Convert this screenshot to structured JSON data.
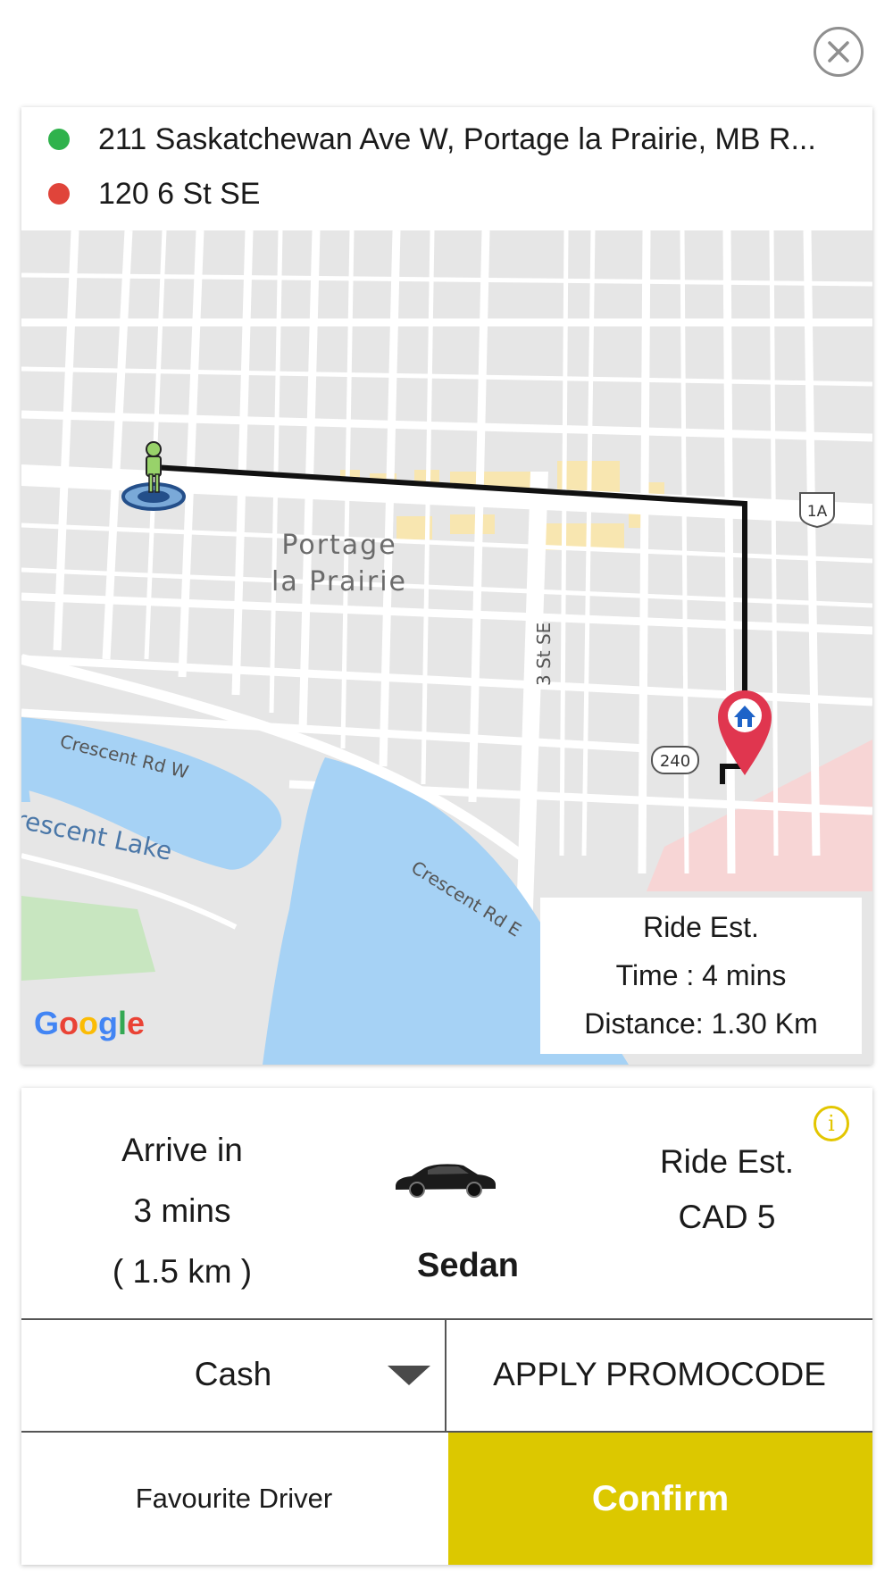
{
  "route": {
    "pickup": "211 Saskatchewan Ave W, Portage la Prairie, MB R...",
    "dropoff": "120 6 St SE",
    "pickup_color": "#2fb24c",
    "dropoff_color": "#e0443a"
  },
  "map": {
    "city_label_line1": "Portage",
    "city_label_line2": "la Prairie",
    "street_3st": "3 St SE",
    "street_crescent_w": "Crescent Rd W",
    "street_crescent_e": "Crescent Rd E",
    "lake_label": "rescent Lake",
    "highway_1a": "1A",
    "highway_240": "240",
    "google_logo": "Google",
    "ride_est": {
      "title": "Ride Est.",
      "time": "Time : 4 mins",
      "distance": "Distance: 1.30 Km"
    }
  },
  "ride": {
    "arrive_line1": "Arrive in",
    "arrive_line2": "3 mins",
    "arrive_line3": "( 1.5 km )",
    "vehicle": "Sedan",
    "vehicle_icon": "car-icon",
    "est_line1": "Ride Est.",
    "est_line2": "CAD 5"
  },
  "payment": {
    "method": "Cash",
    "promo": "APPLY PROMOCODE"
  },
  "actions": {
    "favourite": "Favourite Driver",
    "confirm": "Confirm",
    "confirm_color": "#dcc800"
  }
}
